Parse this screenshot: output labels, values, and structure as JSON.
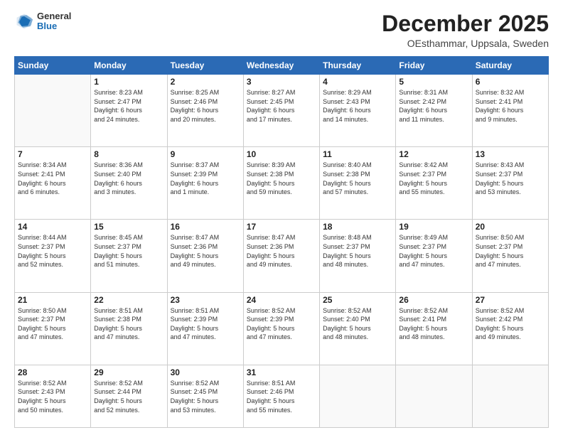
{
  "header": {
    "logo": {
      "general": "General",
      "blue": "Blue"
    },
    "title": "December 2025",
    "location": "OEsthammar, Uppsala, Sweden"
  },
  "days_of_week": [
    "Sunday",
    "Monday",
    "Tuesday",
    "Wednesday",
    "Thursday",
    "Friday",
    "Saturday"
  ],
  "weeks": [
    [
      {
        "day": "",
        "content": ""
      },
      {
        "day": "1",
        "content": "Sunrise: 8:23 AM\nSunset: 2:47 PM\nDaylight: 6 hours\nand 24 minutes."
      },
      {
        "day": "2",
        "content": "Sunrise: 8:25 AM\nSunset: 2:46 PM\nDaylight: 6 hours\nand 20 minutes."
      },
      {
        "day": "3",
        "content": "Sunrise: 8:27 AM\nSunset: 2:45 PM\nDaylight: 6 hours\nand 17 minutes."
      },
      {
        "day": "4",
        "content": "Sunrise: 8:29 AM\nSunset: 2:43 PM\nDaylight: 6 hours\nand 14 minutes."
      },
      {
        "day": "5",
        "content": "Sunrise: 8:31 AM\nSunset: 2:42 PM\nDaylight: 6 hours\nand 11 minutes."
      },
      {
        "day": "6",
        "content": "Sunrise: 8:32 AM\nSunset: 2:41 PM\nDaylight: 6 hours\nand 9 minutes."
      }
    ],
    [
      {
        "day": "7",
        "content": "Sunrise: 8:34 AM\nSunset: 2:41 PM\nDaylight: 6 hours\nand 6 minutes."
      },
      {
        "day": "8",
        "content": "Sunrise: 8:36 AM\nSunset: 2:40 PM\nDaylight: 6 hours\nand 3 minutes."
      },
      {
        "day": "9",
        "content": "Sunrise: 8:37 AM\nSunset: 2:39 PM\nDaylight: 6 hours\nand 1 minute."
      },
      {
        "day": "10",
        "content": "Sunrise: 8:39 AM\nSunset: 2:38 PM\nDaylight: 5 hours\nand 59 minutes."
      },
      {
        "day": "11",
        "content": "Sunrise: 8:40 AM\nSunset: 2:38 PM\nDaylight: 5 hours\nand 57 minutes."
      },
      {
        "day": "12",
        "content": "Sunrise: 8:42 AM\nSunset: 2:37 PM\nDaylight: 5 hours\nand 55 minutes."
      },
      {
        "day": "13",
        "content": "Sunrise: 8:43 AM\nSunset: 2:37 PM\nDaylight: 5 hours\nand 53 minutes."
      }
    ],
    [
      {
        "day": "14",
        "content": "Sunrise: 8:44 AM\nSunset: 2:37 PM\nDaylight: 5 hours\nand 52 minutes."
      },
      {
        "day": "15",
        "content": "Sunrise: 8:45 AM\nSunset: 2:37 PM\nDaylight: 5 hours\nand 51 minutes."
      },
      {
        "day": "16",
        "content": "Sunrise: 8:47 AM\nSunset: 2:36 PM\nDaylight: 5 hours\nand 49 minutes."
      },
      {
        "day": "17",
        "content": "Sunrise: 8:47 AM\nSunset: 2:36 PM\nDaylight: 5 hours\nand 49 minutes."
      },
      {
        "day": "18",
        "content": "Sunrise: 8:48 AM\nSunset: 2:37 PM\nDaylight: 5 hours\nand 48 minutes."
      },
      {
        "day": "19",
        "content": "Sunrise: 8:49 AM\nSunset: 2:37 PM\nDaylight: 5 hours\nand 47 minutes."
      },
      {
        "day": "20",
        "content": "Sunrise: 8:50 AM\nSunset: 2:37 PM\nDaylight: 5 hours\nand 47 minutes."
      }
    ],
    [
      {
        "day": "21",
        "content": "Sunrise: 8:50 AM\nSunset: 2:37 PM\nDaylight: 5 hours\nand 47 minutes."
      },
      {
        "day": "22",
        "content": "Sunrise: 8:51 AM\nSunset: 2:38 PM\nDaylight: 5 hours\nand 47 minutes."
      },
      {
        "day": "23",
        "content": "Sunrise: 8:51 AM\nSunset: 2:39 PM\nDaylight: 5 hours\nand 47 minutes."
      },
      {
        "day": "24",
        "content": "Sunrise: 8:52 AM\nSunset: 2:39 PM\nDaylight: 5 hours\nand 47 minutes."
      },
      {
        "day": "25",
        "content": "Sunrise: 8:52 AM\nSunset: 2:40 PM\nDaylight: 5 hours\nand 48 minutes."
      },
      {
        "day": "26",
        "content": "Sunrise: 8:52 AM\nSunset: 2:41 PM\nDaylight: 5 hours\nand 48 minutes."
      },
      {
        "day": "27",
        "content": "Sunrise: 8:52 AM\nSunset: 2:42 PM\nDaylight: 5 hours\nand 49 minutes."
      }
    ],
    [
      {
        "day": "28",
        "content": "Sunrise: 8:52 AM\nSunset: 2:43 PM\nDaylight: 5 hours\nand 50 minutes."
      },
      {
        "day": "29",
        "content": "Sunrise: 8:52 AM\nSunset: 2:44 PM\nDaylight: 5 hours\nand 52 minutes."
      },
      {
        "day": "30",
        "content": "Sunrise: 8:52 AM\nSunset: 2:45 PM\nDaylight: 5 hours\nand 53 minutes."
      },
      {
        "day": "31",
        "content": "Sunrise: 8:51 AM\nSunset: 2:46 PM\nDaylight: 5 hours\nand 55 minutes."
      },
      {
        "day": "",
        "content": ""
      },
      {
        "day": "",
        "content": ""
      },
      {
        "day": "",
        "content": ""
      }
    ]
  ]
}
